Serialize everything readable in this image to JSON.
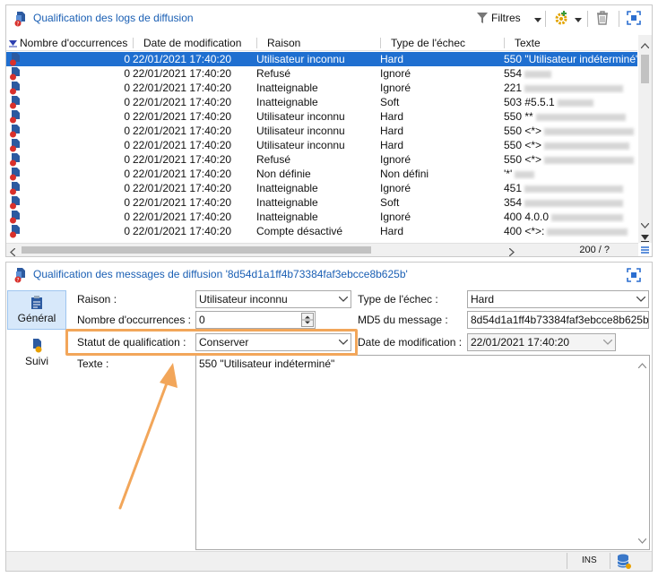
{
  "top_panel": {
    "title": "Qualification des logs de diffusion",
    "filters_label": "Filtres",
    "columns": [
      "Nombre d'occurrences",
      "Date de modification",
      "Raison",
      "Type de l'échec",
      "Texte"
    ],
    "rows": [
      {
        "occ": "0",
        "date": "22/01/2021 17:40:20",
        "raison": "Utilisateur inconnu",
        "type": "Hard",
        "texte": "550 \"Utilisateur indéterminé\"",
        "selected": true
      },
      {
        "occ": "0",
        "date": "22/01/2021 17:40:20",
        "raison": "Refusé",
        "type": "Ignoré",
        "texte": "554"
      },
      {
        "occ": "0",
        "date": "22/01/2021 17:40:20",
        "raison": "Inatteignable",
        "type": "Ignoré",
        "texte": "221"
      },
      {
        "occ": "0",
        "date": "22/01/2021 17:40:20",
        "raison": "Inatteignable",
        "type": "Soft",
        "texte": "503 #5.5.1"
      },
      {
        "occ": "0",
        "date": "22/01/2021 17:40:20",
        "raison": "Utilisateur inconnu",
        "type": "Hard",
        "texte": "550 **"
      },
      {
        "occ": "0",
        "date": "22/01/2021 17:40:20",
        "raison": "Utilisateur inconnu",
        "type": "Hard",
        "texte": "550 <*>"
      },
      {
        "occ": "0",
        "date": "22/01/2021 17:40:20",
        "raison": "Utilisateur inconnu",
        "type": "Hard",
        "texte": "550 <*>"
      },
      {
        "occ": "0",
        "date": "22/01/2021 17:40:20",
        "raison": "Refusé",
        "type": "Ignoré",
        "texte": "550 <*>"
      },
      {
        "occ": "0",
        "date": "22/01/2021 17:40:20",
        "raison": "Non définie",
        "type": "Non défini",
        "texte": "'*'"
      },
      {
        "occ": "0",
        "date": "22/01/2021 17:40:20",
        "raison": "Inatteignable",
        "type": "Ignoré",
        "texte": "451"
      },
      {
        "occ": "0",
        "date": "22/01/2021 17:40:20",
        "raison": "Inatteignable",
        "type": "Soft",
        "texte": "354"
      },
      {
        "occ": "0",
        "date": "22/01/2021 17:40:20",
        "raison": "Inatteignable",
        "type": "Ignoré",
        "texte": "400 4.0.0"
      },
      {
        "occ": "0",
        "date": "22/01/2021 17:40:20",
        "raison": "Compte désactivé",
        "type": "Hard",
        "texte": "400 <*>:"
      }
    ],
    "counter": "200 / ?"
  },
  "bottom_panel": {
    "title": "Qualification des messages de diffusion '8d54d1a1ff4b73384faf3ebcce8b625b'",
    "tabs": [
      {
        "label": "Général",
        "active": true
      },
      {
        "label": "Suivi",
        "active": false
      }
    ],
    "form": {
      "raison_label": "Raison :",
      "raison_value": "Utilisateur inconnu",
      "type_echec_label": "Type de l'échec :",
      "type_echec_value": "Hard",
      "occurrences_label": "Nombre d'occurrences :",
      "occurrences_value": "0",
      "md5_label": "MD5 du message :",
      "md5_value": "8d54d1a1ff4b73384faf3ebcce8b625b",
      "statut_label": "Statut de qualification :",
      "statut_value": "Conserver",
      "date_label": "Date de modification :",
      "date_value": "22/01/2021 17:40:20",
      "texte_label": "Texte :",
      "texte_value": "550 \"Utilisateur indéterminé\""
    },
    "status": {
      "ins": "INS"
    }
  },
  "colors": {
    "title_blue": "#1a5fb4",
    "selection_blue": "#1f6fd0",
    "highlight_orange": "#f2a65a",
    "tab_active": "#d7e8fa"
  },
  "icons": [
    "delivery-log-icon",
    "filter-icon",
    "gear-add-icon",
    "trash-icon",
    "maximize-icon",
    "sort-down-icon",
    "general-tab-icon",
    "tracking-tab-icon",
    "database-icon"
  ]
}
